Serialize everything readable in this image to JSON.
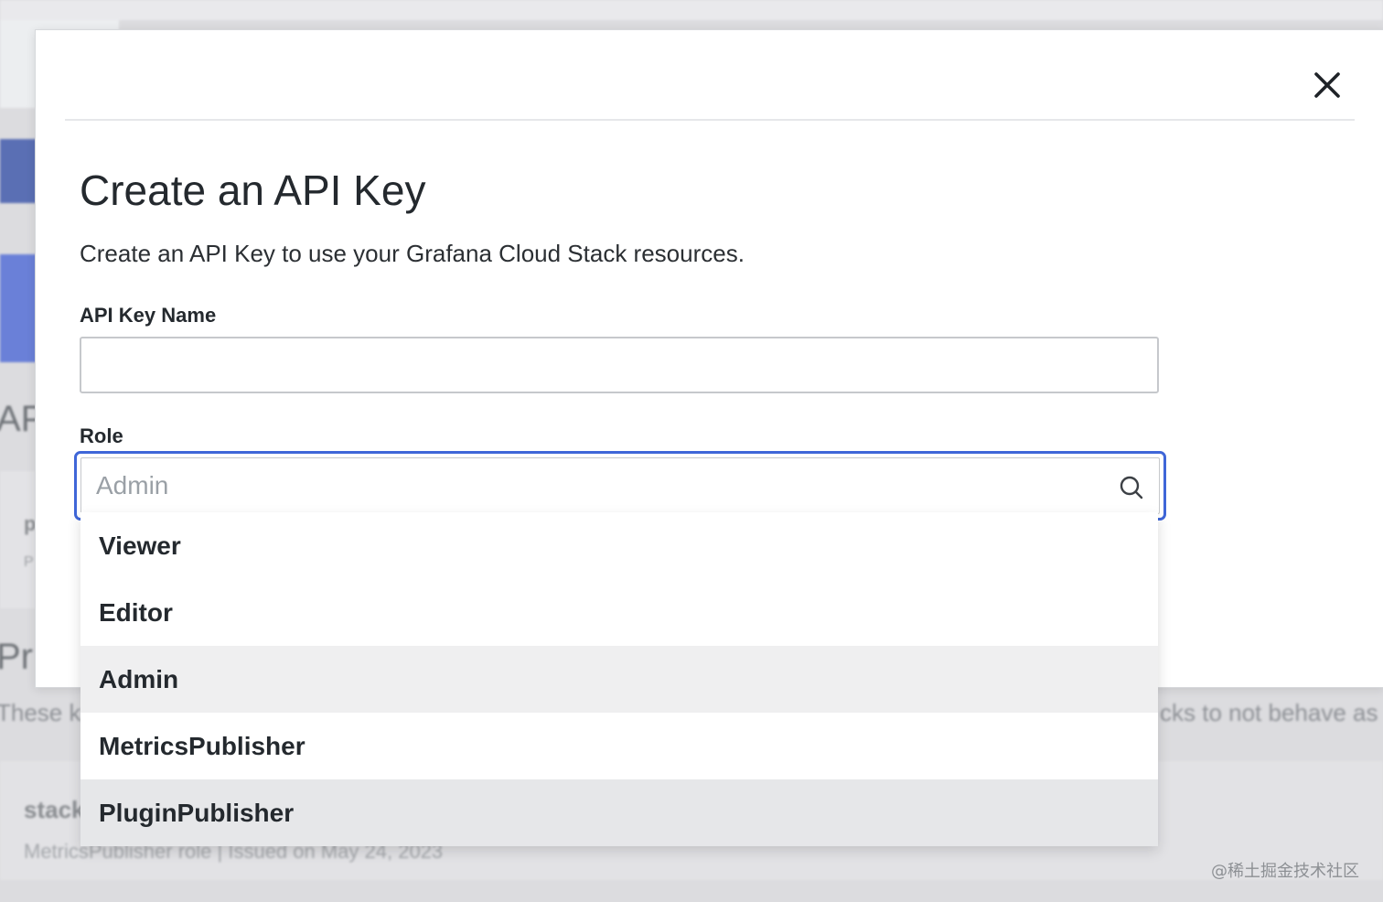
{
  "background": {
    "heading_fragment_1": "AP",
    "heading_fragment_2": "Pr",
    "text_fragment_1": "p",
    "text_fragment_2": "P",
    "description_left": "These k",
    "description_right": "cks to not behave as",
    "row_title": "stack",
    "row_meta": "MetricsPublisher role  |  Issued on May 24, 2023"
  },
  "modal": {
    "title": "Create an API Key",
    "subtitle": "Create an API Key to use your Grafana Cloud Stack resources.",
    "close_icon": "close-icon",
    "name_field": {
      "label": "API Key Name",
      "value": "",
      "placeholder": ""
    },
    "role_field": {
      "label": "Role",
      "value": "",
      "placeholder": "Admin",
      "icon": "search-icon"
    },
    "dropdown": {
      "options": [
        "Viewer",
        "Editor",
        "Admin",
        "MetricsPublisher",
        "PluginPublisher"
      ],
      "highlighted": [
        "Admin",
        "PluginPublisher"
      ]
    }
  },
  "watermark": "@稀土掘金技术社区",
  "colors": {
    "accent": "#3f66d8",
    "text": "#24292e",
    "option_highlight": "#efeff0",
    "backdrop": "#dcdcdf"
  }
}
